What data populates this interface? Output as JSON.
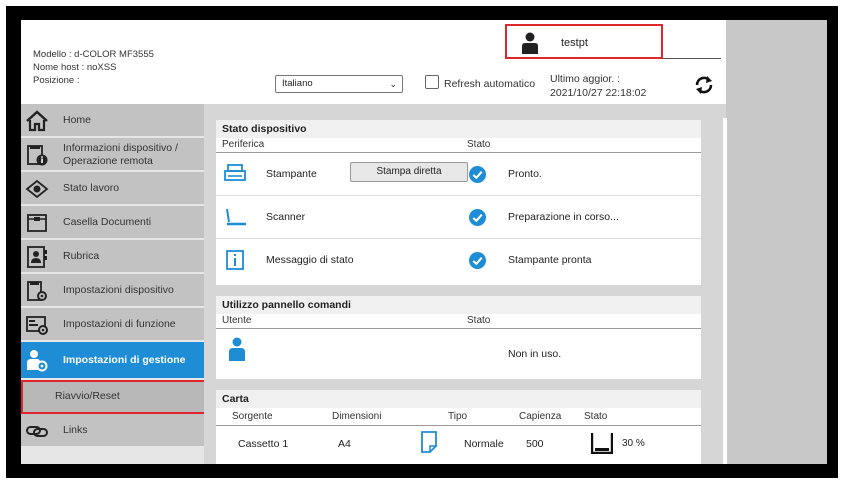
{
  "header": {
    "model_line": "Modello : d-COLOR MF3555",
    "host_line": "Nome host : noXSS",
    "position_line": "Posizione :",
    "user_name": "testpt",
    "language_selected": "Italiano",
    "refresh_label": "Refresh automatico",
    "last_update_label": "Ultimo aggior. :",
    "last_update_value": "2021/10/27 22:18:02"
  },
  "sidebar": {
    "items": [
      {
        "label": "Home",
        "icon": "home-icon"
      },
      {
        "label": "Informazioni dispositivo / Operazione remota",
        "icon": "device-info-icon"
      },
      {
        "label": "Stato lavoro",
        "icon": "eye-icon"
      },
      {
        "label": "Casella Documenti",
        "icon": "document-box-icon"
      },
      {
        "label": "Rubrica",
        "icon": "address-book-icon"
      },
      {
        "label": "Impostazioni dispositivo",
        "icon": "device-settings-icon"
      },
      {
        "label": "Impostazioni di funzione",
        "icon": "function-settings-icon"
      },
      {
        "label": "Impostazioni di gestione",
        "icon": "admin-settings-icon"
      }
    ],
    "sub_item": "Riavvio/Reset",
    "links_label": "Links"
  },
  "device_status": {
    "title": "Stato dispositivo",
    "col_device": "Periferica",
    "col_status": "Stato",
    "rows": [
      {
        "name": "Stampante",
        "status": "Pronto."
      },
      {
        "name": "Scanner",
        "status": "Preparazione in corso..."
      },
      {
        "name": "Messaggio di stato",
        "status": "Stampante pronta"
      }
    ],
    "print_button": "Stampa diretta"
  },
  "panel_usage": {
    "title": "Utilizzo pannello comandi",
    "col_user": "Utente",
    "col_status": "Stato",
    "status_value": "Non in uso."
  },
  "paper": {
    "title": "Carta",
    "columns": [
      "Sorgente",
      "Dimensioni",
      "Tipo",
      "Capienza",
      "Stato"
    ],
    "rows": [
      {
        "source": "Cassetto 1",
        "size": "A4",
        "type": "Normale",
        "capacity": "500",
        "level": "30 %"
      }
    ]
  },
  "colors": {
    "accent": "#1e8dd6",
    "highlight": "#e0262d"
  }
}
